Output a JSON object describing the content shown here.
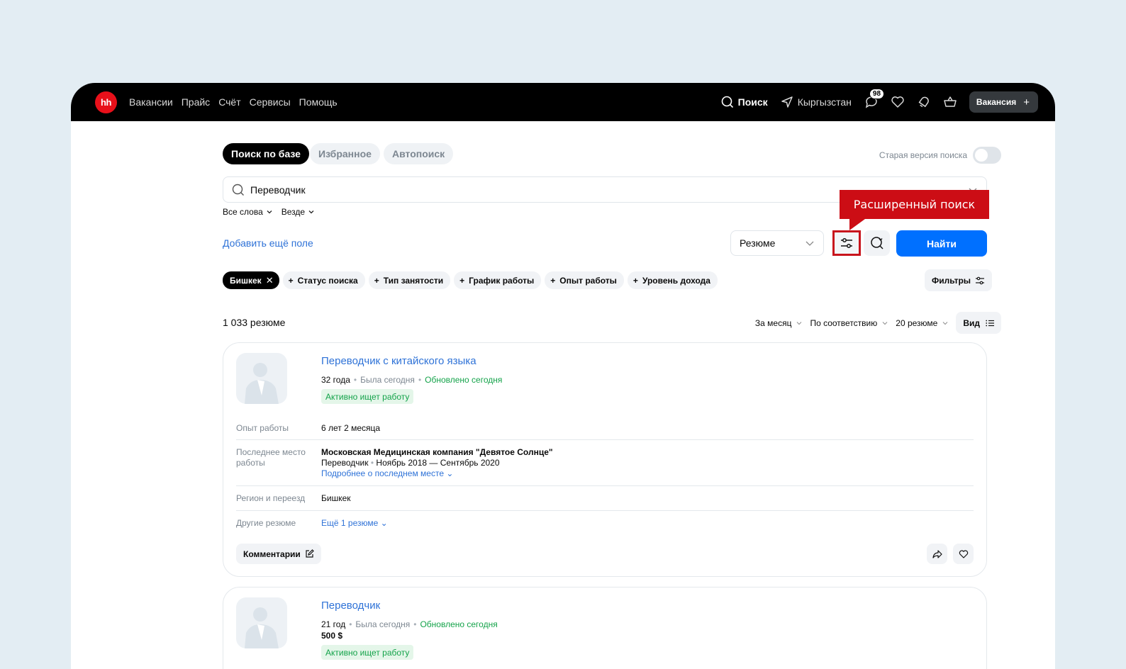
{
  "topbar": {
    "logo": "hh",
    "links": [
      "Вакансии",
      "Прайс",
      "Счёт",
      "Сервисы",
      "Помощь"
    ],
    "search_label": "Поиск",
    "region": "Кыргызстан",
    "messages_badge": "98",
    "vacancy_button": "Вакансия"
  },
  "tabs": [
    "Поиск по базе",
    "Избранное",
    "Автопоиск"
  ],
  "old_version_label": "Старая версия поиска",
  "search": {
    "value": "Переводчик",
    "scope_words": "Все слова",
    "scope_where": "Везде"
  },
  "add_field_label": "Добавить ещё поле",
  "type_select": "Резюме",
  "tooltip": "Расширенный поиск",
  "find_button": "Найти",
  "chips": {
    "active": "Бишкек",
    "items": [
      "Статус поиска",
      "Тип занятости",
      "График работы",
      "Опыт работы",
      "Уровень дохода"
    ]
  },
  "filters_button": "Фильтры",
  "results_count": "1 033 резюме",
  "sort": {
    "period": "За месяц",
    "order": "По соответствию",
    "per_page": "20 резюме",
    "view": "Вид"
  },
  "cards": [
    {
      "title": "Переводчик с китайского языка",
      "age": "32 года",
      "seen": "Была сегодня",
      "updated": "Обновлено сегодня",
      "status": "Активно ищет работу",
      "experience_label": "Опыт работы",
      "experience": "6 лет 2 месяца",
      "last_place_label": "Последнее место работы",
      "last_company": "Московская Медицинская компания \"Девятое Солнце\"",
      "last_position": "Переводчик",
      "last_period": "Ноябрь 2018 — Сентябрь 2020",
      "more_link": "Подробнее о последнем месте",
      "region_label": "Регион и переезд",
      "region": "Бишкек",
      "other_label": "Другие резюме",
      "other_link": "Ещё 1 резюме",
      "comments": "Комментарии"
    },
    {
      "title": "Переводчик",
      "age": "21 год",
      "seen": "Была сегодня",
      "updated": "Обновлено сегодня",
      "salary": "500 $",
      "status": "Активно ищет работу"
    }
  ]
}
